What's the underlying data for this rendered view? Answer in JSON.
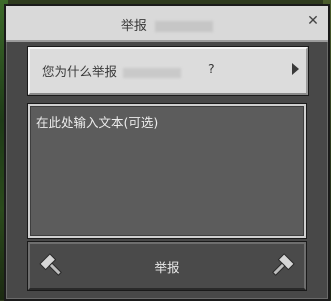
{
  "dialog": {
    "title": "举报",
    "close_icon": "close-icon",
    "reason_button": {
      "label": "您为什么举报",
      "suffix": "?"
    },
    "textarea": {
      "placeholder": "在此处输入文本(可选)"
    },
    "submit": {
      "label": "举报",
      "icon_left": "hammer-icon",
      "icon_right": "hammer-icon"
    }
  },
  "colors": {
    "titlebar_bg": "#d9d9d9",
    "dialog_bg": "#484848",
    "textarea_bg": "#5c5c5c",
    "text_light": "#ececec"
  }
}
